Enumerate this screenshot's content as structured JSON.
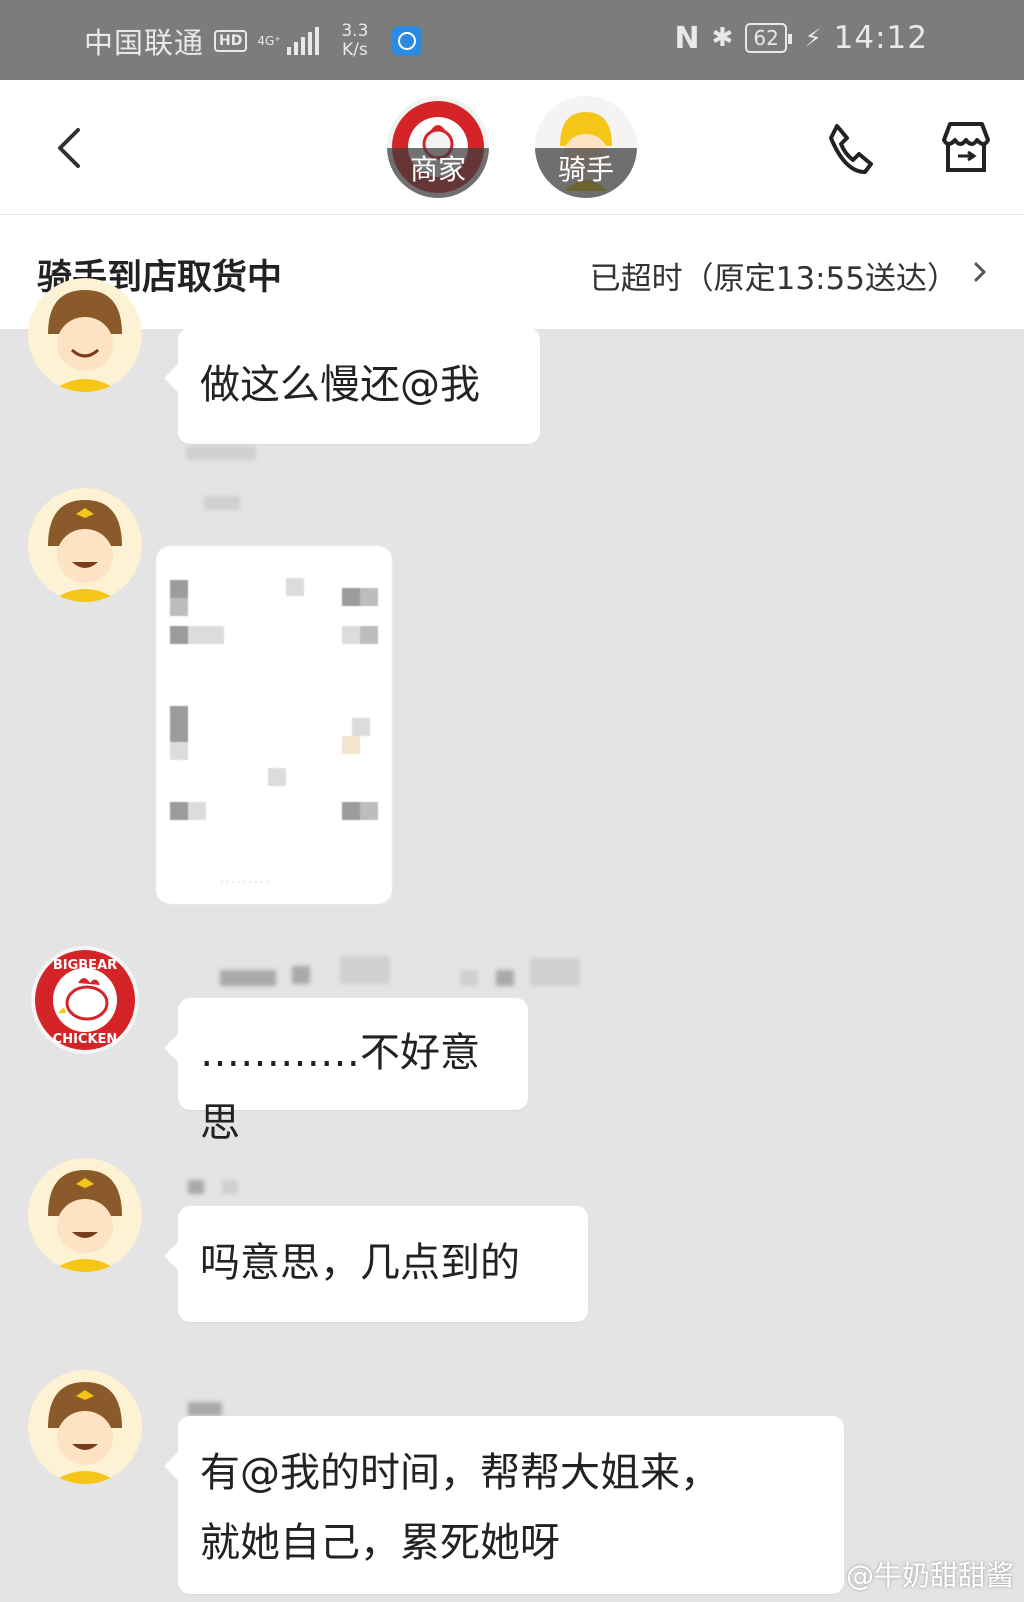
{
  "status_bar": {
    "carrier": "中国联通",
    "hd": "HD",
    "network": "4G⁺",
    "speed_value": "3.3",
    "speed_unit": "K/s",
    "battery": "62",
    "time": "14:12"
  },
  "header": {
    "merchant_label": "商家",
    "merchant_logo_text": "BIGBEAR CHICKEN",
    "rider_label": "骑手"
  },
  "order": {
    "status": "骑手到店取货中",
    "time_note": "已超时（原定13:55送达）"
  },
  "messages": [
    {
      "sender": "rider",
      "text": "做这么慢还@我"
    },
    {
      "sender": "rider",
      "type": "image"
    },
    {
      "sender": "merchant",
      "text": "…………不好意思"
    },
    {
      "sender": "rider",
      "text": "吗意思，几点到的"
    },
    {
      "sender": "rider",
      "line1": "有@我的时间，帮帮大姐来，",
      "line2": "就她自己，累死她呀"
    }
  ],
  "watermark": "@牛奶甜甜酱",
  "colors": {
    "chat_background": "#e4e4e4",
    "status_bar": "#7c7c7c",
    "bubble": "#ffffff",
    "merchant_red": "#d42428",
    "rider_yellow": "#f5c518"
  }
}
